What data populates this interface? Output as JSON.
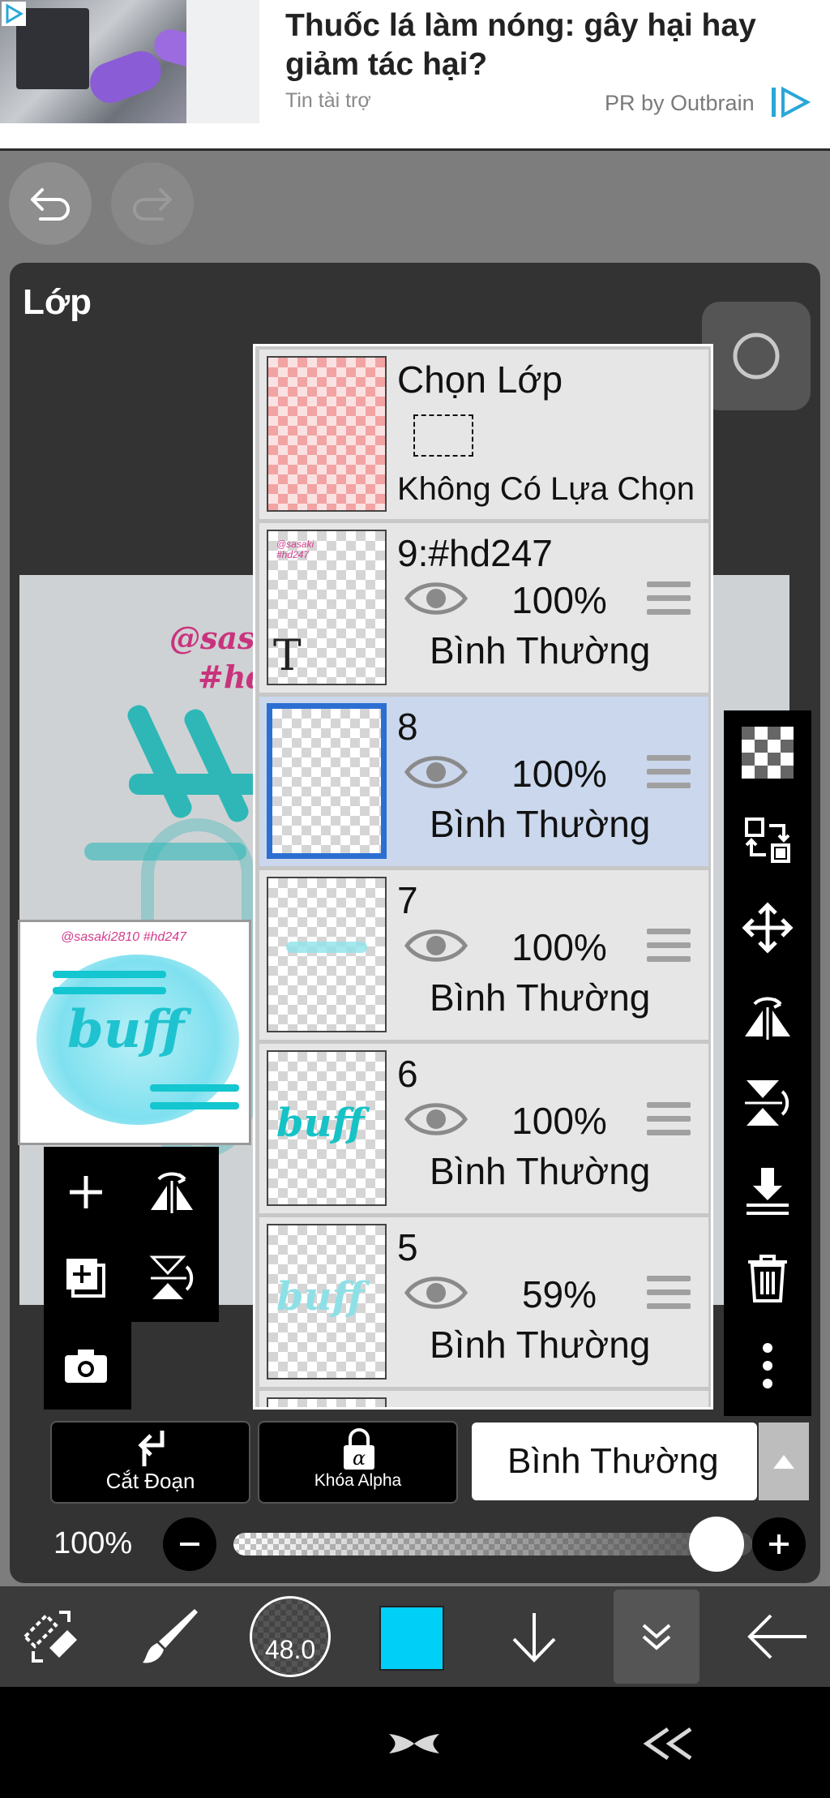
{
  "ad": {
    "title": "Thuốc lá làm nóng: gây hại hay giảm tác hại?",
    "sponsor": "Tin tài trợ",
    "provider": "PR by Outbrain"
  },
  "panel": {
    "title": "Lớp"
  },
  "canvas": {
    "tag1": "@sasak",
    "tag2": "#hd",
    "preview_tag": "@sasaki2810 #hd247",
    "preview_word": "buff"
  },
  "selection_layer": {
    "title": "Chọn Lớp",
    "status": "Không Có Lựa Chọn"
  },
  "layers": [
    {
      "name": "9:#hd247",
      "opacity": "100%",
      "blend": "Bình Thường",
      "selected": false
    },
    {
      "name": "8",
      "opacity": "100%",
      "blend": "Bình Thường",
      "selected": true
    },
    {
      "name": "7",
      "opacity": "100%",
      "blend": "Bình Thường",
      "selected": false
    },
    {
      "name": "6",
      "opacity": "100%",
      "blend": "Bình Thường",
      "selected": false
    },
    {
      "name": "5",
      "opacity": "59%",
      "blend": "Bình Thường",
      "selected": false
    }
  ],
  "bottom": {
    "clip_label": "Cắt Đoạn",
    "alpha_lock_label": "Khóa Alpha",
    "blend_mode": "Bình Thường",
    "opacity_label": "100%",
    "opacity_value": 1.0
  },
  "toolbar": {
    "brush_size": "48.0",
    "color": "#00cff7"
  },
  "colors": {
    "accent": "#2c6fd1",
    "selected_row": "#cad7ec"
  }
}
